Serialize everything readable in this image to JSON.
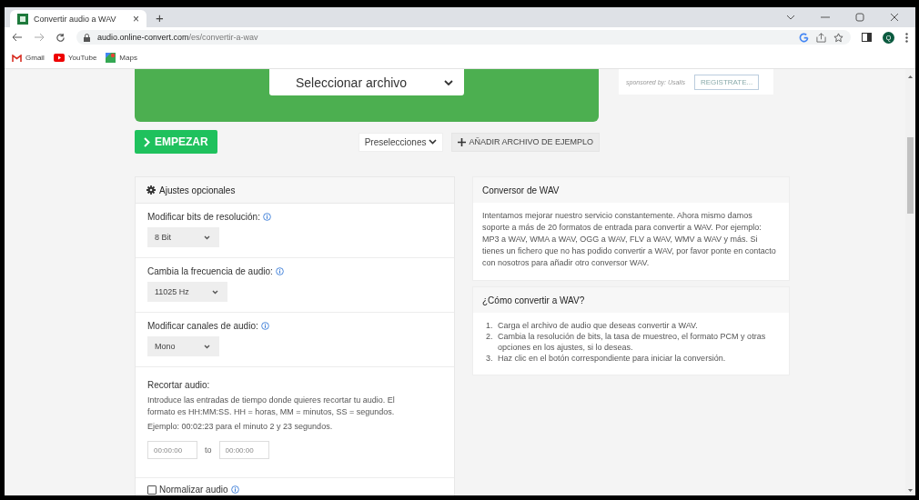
{
  "browser": {
    "tab": {
      "title": "Convertir audio a WAV",
      "close": "×"
    },
    "new_tab": "+",
    "url": {
      "host": "audio.online-convert.com",
      "path": "/es/convertir-a-wav"
    },
    "avatar": "Q",
    "bookmarks": [
      {
        "label": "Gmail",
        "kind": "gmail"
      },
      {
        "label": "YouTube",
        "kind": "youtube"
      },
      {
        "label": "Maps",
        "kind": "maps"
      }
    ]
  },
  "upload": {
    "button": "Seleccionar archivo",
    "sponsor": {
      "text": "sponsored by: Usalis",
      "button": "REGISTRATE..."
    }
  },
  "actions": {
    "start": "EMPEZAR",
    "presets": "Preselecciones",
    "add_sample": "AÑADIR ARCHIVO DE EJEMPLO"
  },
  "settings": {
    "title": "Ajustes opcionales",
    "selects": [
      {
        "label": "Modificar bits de resolución:",
        "value": "8 Bit"
      },
      {
        "label": "Cambia la frecuencia de audio:",
        "value": "11025 Hz"
      },
      {
        "label": "Modificar canales de audio:",
        "value": "Mono"
      }
    ],
    "trim": {
      "label": "Recortar audio:",
      "description": "Introduce las entradas de tiempo donde quieres recortar tu audio. El formato es HH:MM:SS. HH = horas, MM = minutos, SS = segundos.",
      "example": "Ejemplo: 00:02:23 para el minuto 2 y 23 segundos.",
      "from_placeholder": "00:00:00",
      "to_label": "to",
      "to_placeholder": "00:00:00"
    },
    "normalize": {
      "label": "Normalizar audio",
      "checked": false
    }
  },
  "cards": [
    {
      "title": "Conversor de WAV",
      "kind": "paragraph",
      "text": "Intentamos mejorar nuestro servicio constantemente. Ahora mismo damos soporte a más de 20 formatos de entrada para convertir a WAV. Por ejemplo: MP3 a WAV, WMA a WAV, OGG a WAV, FLV a WAV, WMV a WAV y más. Si tienes un fichero que no has podido convertir a WAV, por favor ponte en contacto con nosotros para añadir otro conversor WAV."
    },
    {
      "title": "¿Cómo convertir a WAV?",
      "kind": "list",
      "steps": [
        {
          "number": "1.",
          "text": "Carga el archivo de audio que deseas convertir a WAV."
        },
        {
          "number": "2.",
          "text": "Cambia la resolución de bits, la tasa de muestreo, el formato PCM y otras opciones en los ajustes, si lo deseas."
        },
        {
          "number": "3.",
          "text": "Haz clic en el botón correspondiente para iniciar la conversión."
        }
      ]
    }
  ]
}
